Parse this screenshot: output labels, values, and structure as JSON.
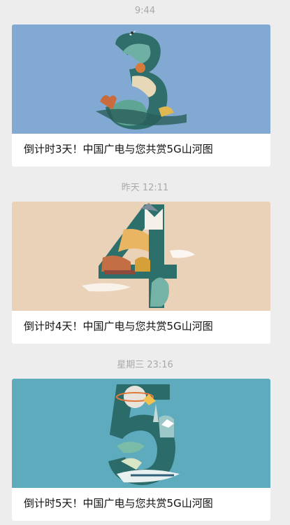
{
  "feed": {
    "items": [
      {
        "time": "9:44",
        "title": "倒计时3天！中国广电与您共赏5G山河图",
        "cover": {
          "digit": "3",
          "background": "#7ea6d0",
          "accent": "#2f6e6a"
        }
      },
      {
        "time": "昨天  12:11",
        "title": "倒计时4天！中国广电与您共赏5G山河图",
        "cover": {
          "digit": "4",
          "background": "#ead2b9",
          "accent": "#2d6f6a"
        }
      },
      {
        "time": "星期三  23:16",
        "title": "倒计时5天！中国广电与您共赏5G山河图",
        "cover": {
          "digit": "5",
          "background": "#5eabbd",
          "accent": "#2b6b6a"
        }
      }
    ]
  }
}
